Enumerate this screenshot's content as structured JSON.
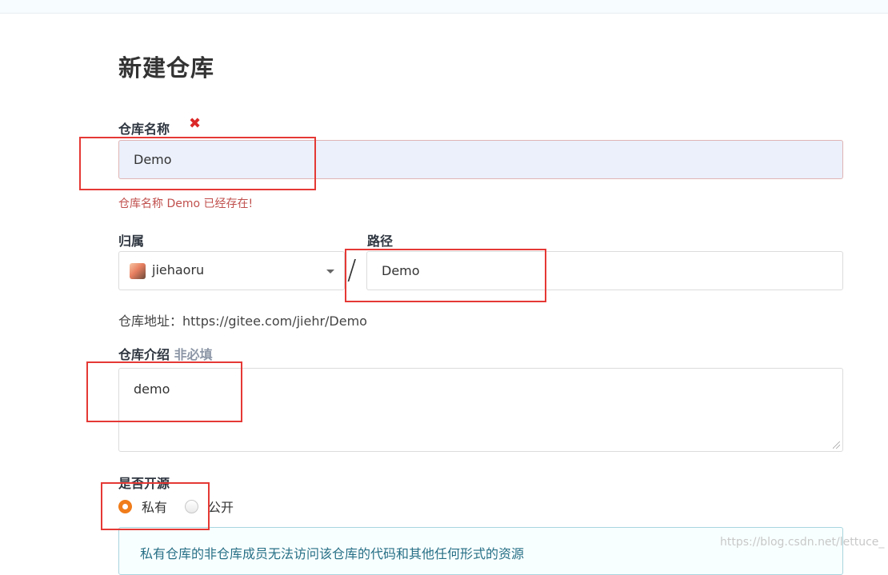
{
  "page": {
    "title": "新建仓库"
  },
  "repo_name": {
    "label": "仓库名称",
    "required_icon": "close-icon",
    "required_glyph": "✖",
    "value": "Demo",
    "error": "仓库名称 Demo 已经存在!"
  },
  "owner": {
    "label": "归属",
    "selected": "jiehaoru",
    "avatar_icon": "user-avatar"
  },
  "path": {
    "label": "路径",
    "separator": "/",
    "value": "Demo"
  },
  "address": {
    "label": "仓库地址：",
    "url": "https://gitee.com/jiehr/Demo"
  },
  "description": {
    "label": "仓库介绍",
    "optional": "非必填",
    "value": "demo"
  },
  "visibility": {
    "label": "是否开源",
    "options": [
      {
        "label": "私有",
        "checked": true
      },
      {
        "label": "公开",
        "checked": false
      }
    ],
    "info": "私有仓库的非仓库成员无法访问该仓库的代码和其他任何形式的资源"
  },
  "watermark": "https://blog.csdn.net/lettuce_",
  "colors": {
    "accent_radio": "#f07c1a",
    "error_text": "#c0504d",
    "highlight_box": "#e53935",
    "info_text": "#276f86"
  }
}
